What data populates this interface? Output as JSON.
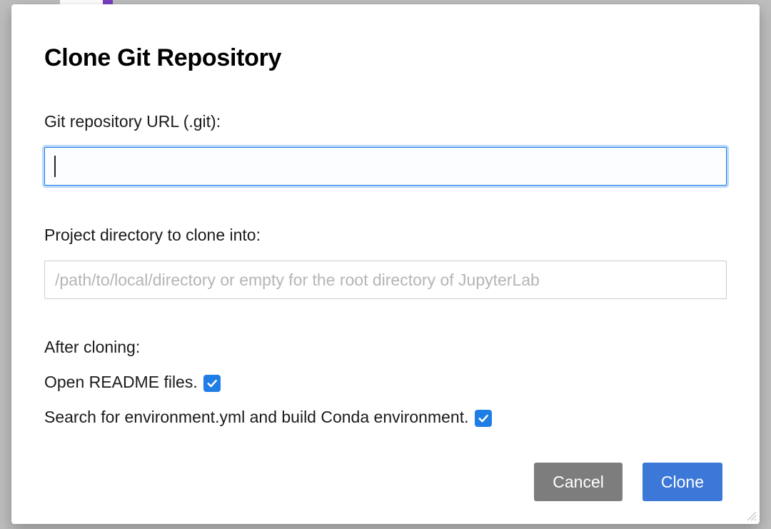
{
  "dialog": {
    "title": "Clone Git Repository",
    "url_label": "Git repository URL (.git):",
    "url_value": "",
    "dir_label": "Project directory to clone into:",
    "dir_value": "",
    "dir_placeholder": "/path/to/local/directory or empty for the root directory of JupyterLab",
    "after_label": "After cloning:",
    "checkbox_readme_label": "Open README files.",
    "checkbox_readme_checked": true,
    "checkbox_conda_label": "Search for environment.yml and build Conda environment.",
    "checkbox_conda_checked": true,
    "cancel_label": "Cancel",
    "clone_label": "Clone"
  }
}
